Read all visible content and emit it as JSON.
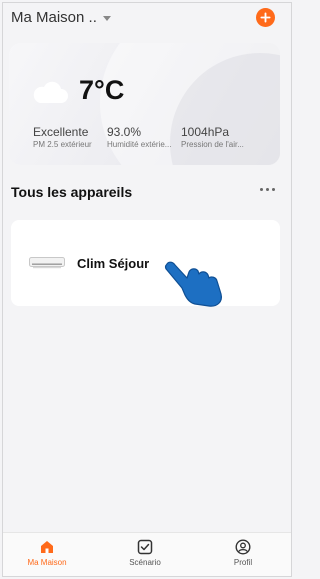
{
  "header": {
    "home_name": "Ma Maison ..",
    "add_icon": "plus-icon",
    "accent_color": "#ff6a1a"
  },
  "weather": {
    "condition_icon": "cloud-icon",
    "temperature": "7°C",
    "metrics": [
      {
        "value": "Excellente",
        "label": "PM 2.5 extérieur"
      },
      {
        "value": "93.0%",
        "label": "Humidité extérie..."
      },
      {
        "value": "1004hPa",
        "label": "Pression de l'air..."
      }
    ]
  },
  "devices_section": {
    "title": "Tous les appareils",
    "more_icon": "more-horizontal-icon"
  },
  "devices": [
    {
      "name": "Clim Séjour",
      "icon": "air-conditioner-icon"
    }
  ],
  "bottom_nav": [
    {
      "label": "Ma Maison",
      "icon": "home-icon",
      "active": true
    },
    {
      "label": "Scénario",
      "icon": "scenario-check-icon",
      "active": false
    },
    {
      "label": "Profil",
      "icon": "profile-icon",
      "active": false
    }
  ]
}
